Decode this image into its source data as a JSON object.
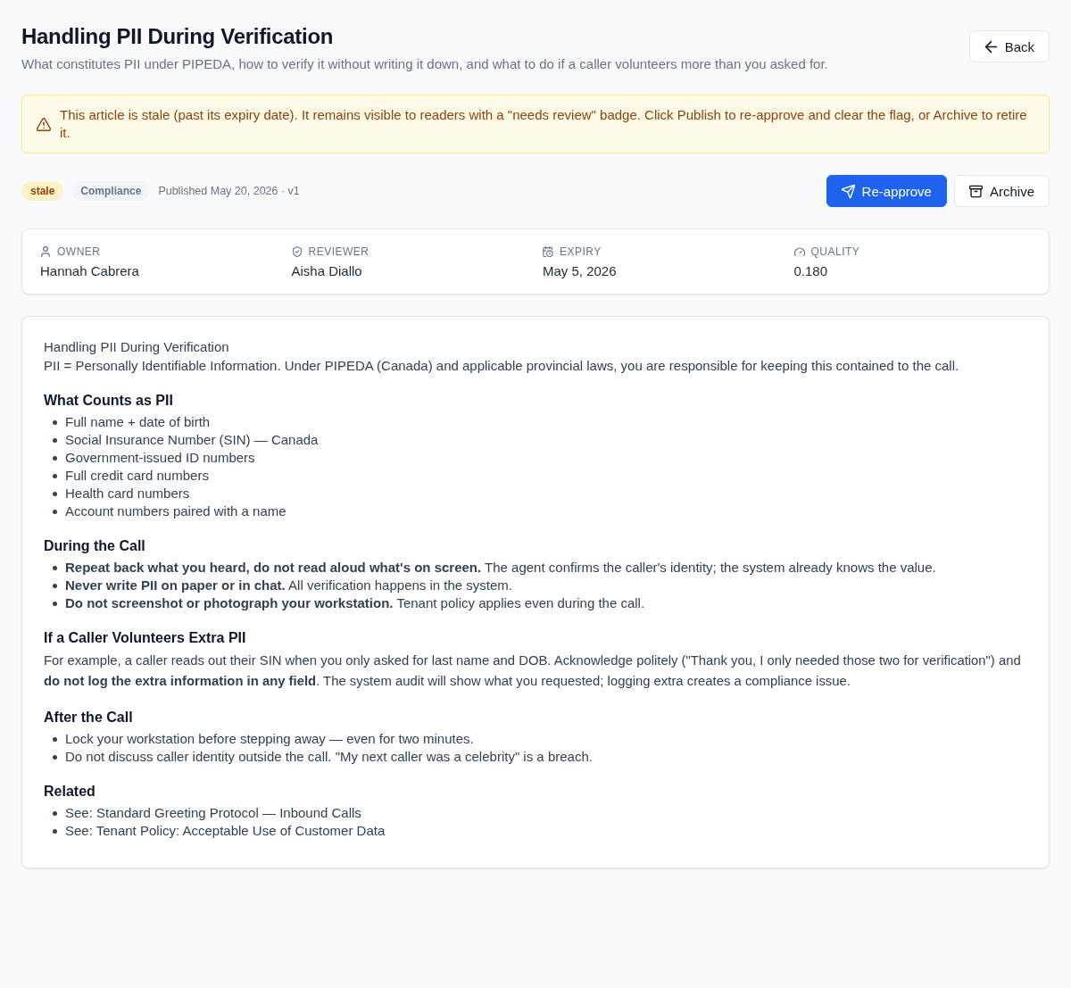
{
  "header": {
    "title": "Handling PII During Verification",
    "subtitle": "What constitutes PII under PIPEDA, how to verify it without writing it down, and what to do if a caller volunteers more than you asked for.",
    "back_button": "Back"
  },
  "alert": {
    "kind": "warning",
    "text": "This article is stale (past its expiry date). It remains visible to readers with a \"needs review\" badge. Click Publish to re-approve and clear the flag, or Archive to retire it."
  },
  "tags": [
    {
      "label": "stale",
      "kind": "status"
    },
    {
      "label": "Compliance",
      "kind": "category"
    }
  ],
  "published": "Published May 20, 2026 · v1",
  "actions": [
    {
      "label": "Re-approve",
      "kind": "primary"
    },
    {
      "label": "Archive",
      "kind": "secondary"
    }
  ],
  "meta": [
    {
      "label": "OWNER",
      "value": "Hannah Cabrera"
    },
    {
      "label": "REVIEWER",
      "value": "Aisha Diallo"
    },
    {
      "label": "EXPIRY",
      "value": "May 5, 2026"
    },
    {
      "label": "QUALITY",
      "value": "0.180"
    }
  ],
  "article": [
    {
      "kind": "line",
      "text": "Handling PII During Verification"
    },
    {
      "kind": "line",
      "text": "PII = Personally Identifiable Information. Under PIPEDA (Canada) and applicable provincial laws, you are responsible for keeping this contained to the call."
    },
    {
      "kind": "heading",
      "text": "What Counts as PII"
    },
    {
      "kind": "list",
      "items": [
        "Full name + date of birth",
        "Social Insurance Number (SIN) — Canada",
        "Government-issued ID numbers",
        "Full credit card numbers",
        "Health card numbers",
        "Account numbers paired with a name"
      ]
    },
    {
      "kind": "heading",
      "text": "During the Call"
    },
    {
      "kind": "list",
      "items": [
        "**Repeat back what you heard, do not read aloud what's on screen.** The agent confirms the caller's identity; the system already knows the value.",
        "**Never write PII on paper or in chat.** All verification happens in the system.",
        "**Do not screenshot or photograph your workstation.** Tenant policy applies even during the call."
      ]
    },
    {
      "kind": "heading",
      "text": "If a Caller Volunteers Extra PII"
    },
    {
      "kind": "paragraph",
      "text": "For example, a caller reads out their SIN when you only asked for last name and DOB. Acknowledge politely (\"Thank you, I only needed those two for verification\") and **do not log the extra information in any field**. The system audit will show what you requested; logging extra creates a compliance issue."
    },
    {
      "kind": "heading",
      "text": "After the Call"
    },
    {
      "kind": "list",
      "items": [
        "Lock your workstation before stepping away — even for two minutes.",
        "Do not discuss caller identity outside the call. \"My next caller was a celebrity\" is a breach."
      ]
    },
    {
      "kind": "heading",
      "text": "Related"
    },
    {
      "kind": "list",
      "items": [
        "See: Standard Greeting Protocol — Inbound Calls",
        "See: Tenant Policy: Acceptable Use of Customer Data"
      ]
    }
  ]
}
